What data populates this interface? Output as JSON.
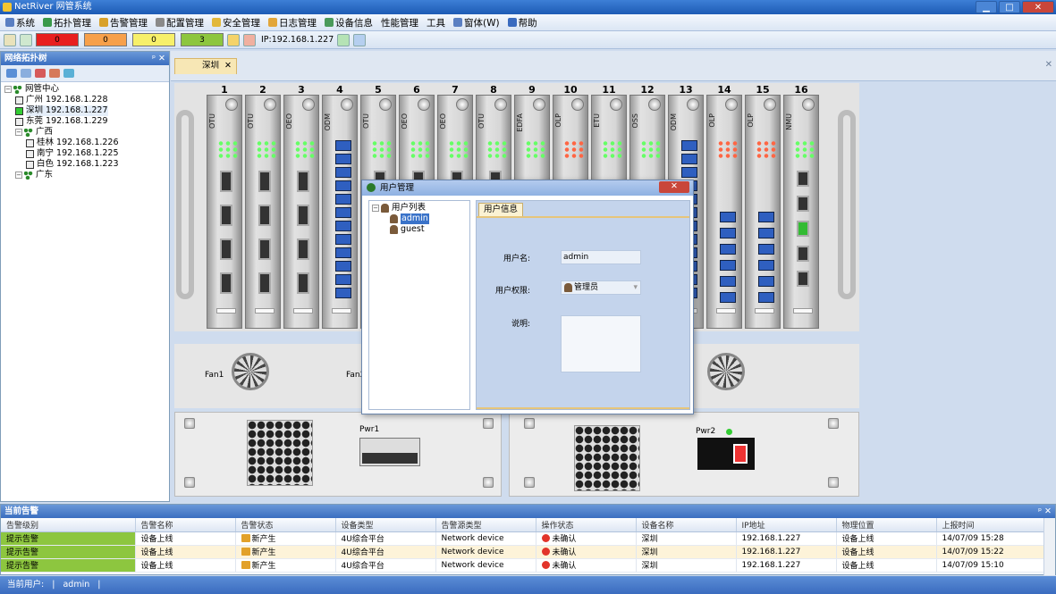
{
  "window": {
    "title": "NetRiver 网管系统",
    "buttons": [
      "▁",
      "□",
      "✕"
    ]
  },
  "menu": [
    {
      "label": "系统",
      "color": "#5a7fc2"
    },
    {
      "label": "拓扑管理",
      "color": "#3a9a4a"
    },
    {
      "label": "告警管理",
      "color": "#d8a12a"
    },
    {
      "label": "配置管理",
      "color": "#8a8a8a"
    },
    {
      "label": "安全管理",
      "color": "#e2b83a"
    },
    {
      "label": "日志管理",
      "color": "#e2a63a"
    },
    {
      "label": "设备信息",
      "color": "#4a9a5a"
    },
    {
      "label": "性能管理",
      "color": ""
    },
    {
      "label": "工具",
      "color": ""
    },
    {
      "label": "窗体(W)",
      "color": "#5a7fc2"
    },
    {
      "label": "帮助",
      "color": "#3a6bbf"
    }
  ],
  "toolbar": {
    "alarms": [
      {
        "value": "0",
        "color": "#e81f1f"
      },
      {
        "value": "0",
        "color": "#f7a04a"
      },
      {
        "value": "0",
        "color": "#f7f06a"
      },
      {
        "value": "3",
        "color": "#8dc63f"
      }
    ],
    "ip": "IP:192.168.1.227"
  },
  "left_panel": {
    "title": "网络拓扑树",
    "pin": "ᵖ ✕",
    "tree": [
      {
        "label": "网管中心",
        "level": 0,
        "type": "group"
      },
      {
        "label": "广州 192.168.1.228",
        "level": 1,
        "type": "node"
      },
      {
        "label": "深圳 192.168.1.227",
        "level": 1,
        "type": "node",
        "selected": true
      },
      {
        "label": "东莞 192.168.1.229",
        "level": 1,
        "type": "node"
      },
      {
        "label": "广西",
        "level": 1,
        "type": "group"
      },
      {
        "label": "桂林 192.168.1.226",
        "level": 2,
        "type": "node"
      },
      {
        "label": "南宁 192.168.1.225",
        "level": 2,
        "type": "node"
      },
      {
        "label": "白色 192.168.1.223",
        "level": 2,
        "type": "node"
      },
      {
        "label": "广东",
        "level": 1,
        "type": "group"
      }
    ]
  },
  "main": {
    "tab": "深圳",
    "tab_close": "✕",
    "panel_close": "✕"
  },
  "chassis": {
    "slots": [
      {
        "num": "1",
        "type": "OTU"
      },
      {
        "num": "2",
        "type": "OTU"
      },
      {
        "num": "3",
        "type": "OEO"
      },
      {
        "num": "4",
        "type": "ODM"
      },
      {
        "num": "5",
        "type": "OTU"
      },
      {
        "num": "6",
        "type": "OEO"
      },
      {
        "num": "7",
        "type": "OEO"
      },
      {
        "num": "8",
        "type": "OTU"
      },
      {
        "num": "9",
        "type": "EDFA"
      },
      {
        "num": "10",
        "type": "OLP"
      },
      {
        "num": "11",
        "type": "ETU"
      },
      {
        "num": "12",
        "type": "OSS"
      },
      {
        "num": "13",
        "type": "ODM"
      },
      {
        "num": "14",
        "type": "OLP"
      },
      {
        "num": "15",
        "type": "OLP"
      },
      {
        "num": "16",
        "type": "NMU"
      }
    ],
    "fans": [
      "Fan1",
      "Fan2"
    ],
    "pwr": [
      "Pwr1",
      "Pwr2"
    ]
  },
  "dialog": {
    "title": "用户管理",
    "close": "✕",
    "tree_root": "用户列表",
    "users": [
      "admin",
      "guest"
    ],
    "tab": "用户信息",
    "username_label": "用户名:",
    "username": "admin",
    "role_label": "用户权限:",
    "role": "管理员",
    "desc_label": "说明:"
  },
  "alarms": {
    "title": "当前告警",
    "pin": "ᵖ ✕",
    "columns": [
      "告警级别",
      "告警名称",
      "告警状态",
      "设备类型",
      "告警源类型",
      "操作状态",
      "设备名称",
      "IP地址",
      "物理位置",
      "上报时间"
    ],
    "rows": [
      [
        "提示告警",
        "设备上线",
        "新产生",
        "4U综合平台",
        "Network device",
        "未确认",
        "深圳",
        "192.168.1.227",
        "设备上线",
        "14/07/09 15:28"
      ],
      [
        "提示告警",
        "设备上线",
        "新产生",
        "4U综合平台",
        "Network device",
        "未确认",
        "深圳",
        "192.168.1.227",
        "设备上线",
        "14/07/09 15:22"
      ],
      [
        "提示告警",
        "设备上线",
        "新产生",
        "4U综合平台",
        "Network device",
        "未确认",
        "深圳",
        "192.168.1.227",
        "设备上线",
        "14/07/09 15:10"
      ]
    ]
  },
  "status": {
    "label": "当前用户:",
    "user": "admin"
  }
}
